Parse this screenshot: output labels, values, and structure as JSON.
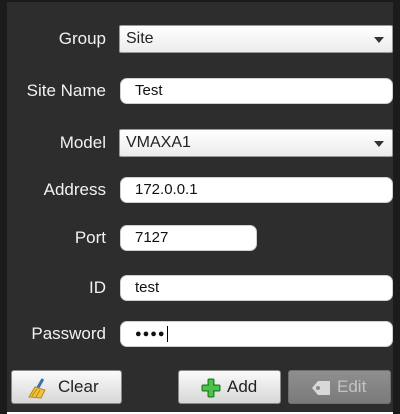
{
  "form": {
    "group": {
      "label": "Group",
      "value": "Site"
    },
    "site_name": {
      "label": "Site Name",
      "value": "Test"
    },
    "model": {
      "label": "Model",
      "value": "VMAXA1"
    },
    "address": {
      "label": "Address",
      "value": "172.0.0.1"
    },
    "port": {
      "label": "Port",
      "value": "7127"
    },
    "id": {
      "label": "ID",
      "value": "test"
    },
    "password": {
      "label": "Password",
      "value": "●●●●"
    }
  },
  "buttons": {
    "clear_label": "Clear",
    "add_label": "Add",
    "edit_label": "Edit"
  },
  "icons": {
    "clear": "broom-icon",
    "add": "plus-icon",
    "edit": "tag-icon",
    "dropdown": "chevron-down-icon"
  }
}
